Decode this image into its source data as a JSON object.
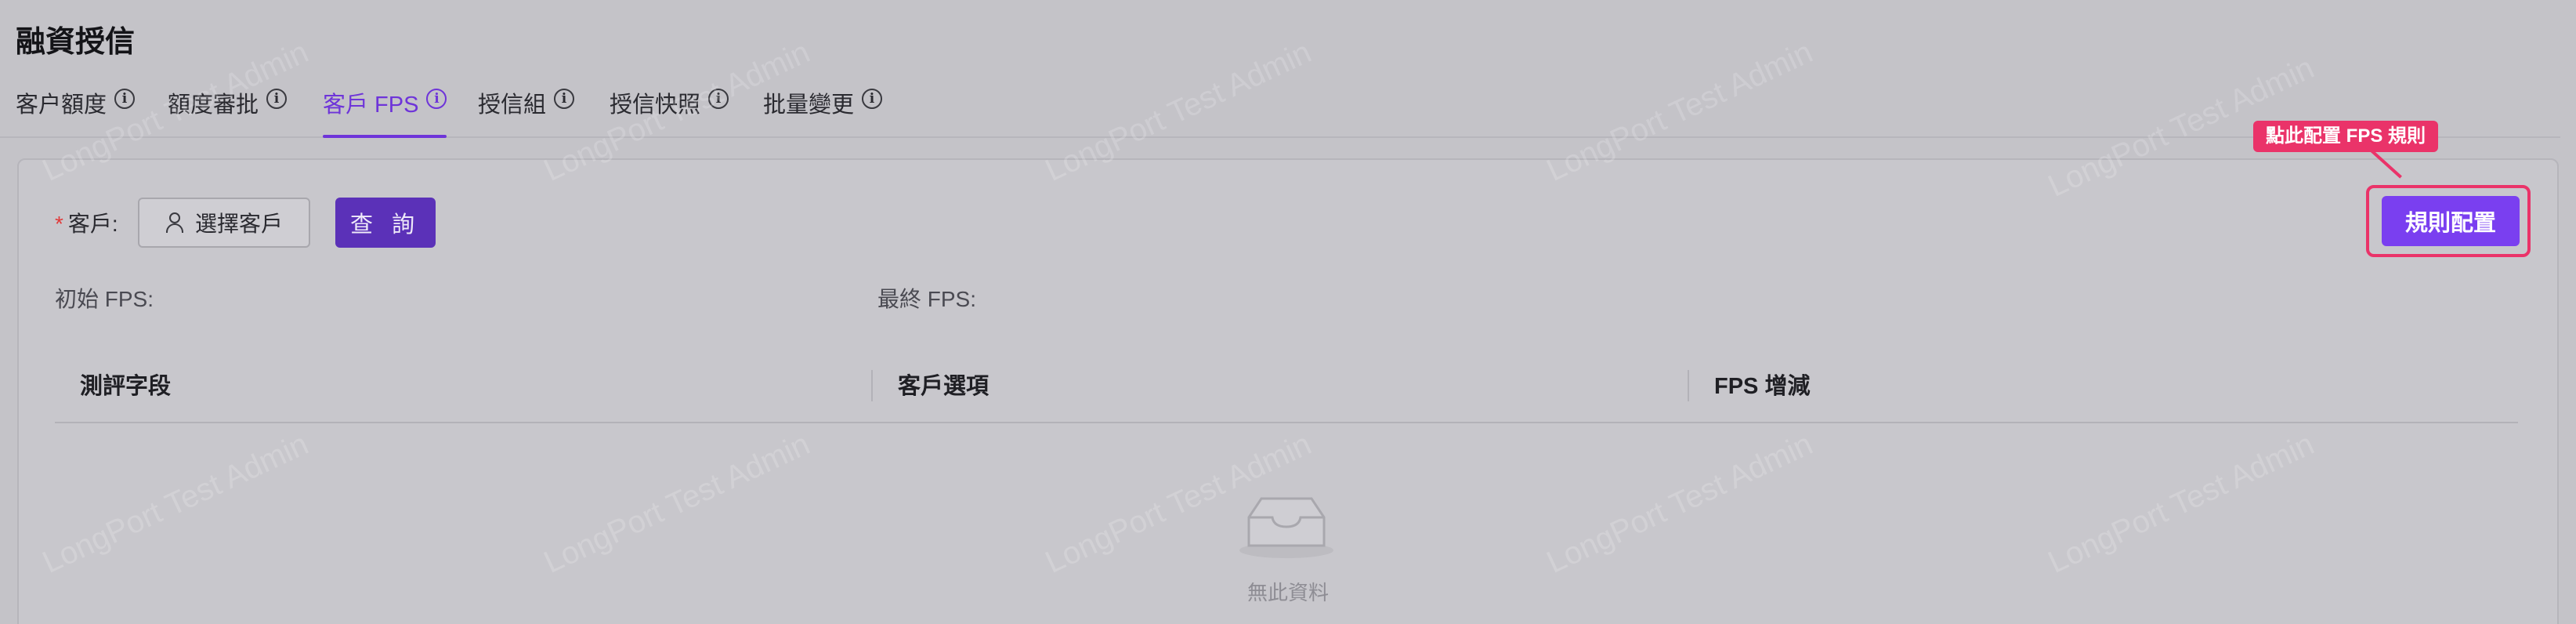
{
  "page": {
    "title": "融資授信"
  },
  "tabs": [
    {
      "label": "客户額度",
      "active": false
    },
    {
      "label": "額度審批",
      "active": false
    },
    {
      "label": "客戶 FPS",
      "active": true
    },
    {
      "label": "授信組",
      "active": false
    },
    {
      "label": "授信快照",
      "active": false
    },
    {
      "label": "批量變更",
      "active": false
    }
  ],
  "filters": {
    "customer_label": "客戶",
    "required_mark": "*",
    "select_customer_label": "選擇客戶",
    "query_label": "查 詢"
  },
  "rule_config": {
    "button_label": "規則配置",
    "tooltip": "點此配置 FPS 規則"
  },
  "fps_info": {
    "initial_label": "初始 FPS:",
    "final_label": "最終 FPS:"
  },
  "table": {
    "columns": [
      "測評字段",
      "客戶選項",
      "FPS 增減"
    ],
    "empty_text": "無此資料"
  },
  "watermark": "LongPort Test Admin",
  "colors": {
    "accent": "#6e34d9",
    "primary_button": "#5b31b8",
    "rule_button": "#7a3ff0",
    "highlight": "#ea3369"
  }
}
